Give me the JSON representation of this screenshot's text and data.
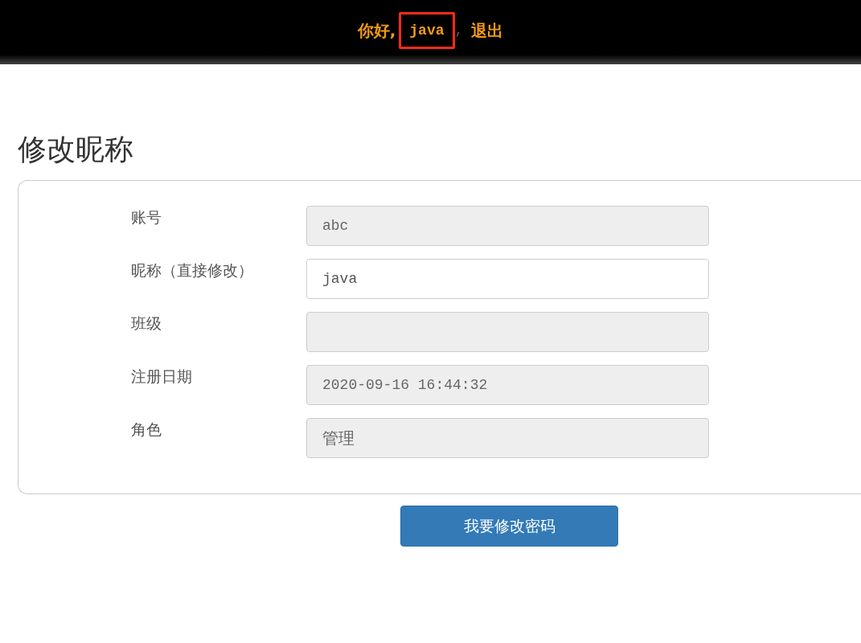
{
  "header": {
    "greeting": "你好,",
    "username": {
      "text": "java",
      "highlighted": true
    },
    "separator": ",",
    "logout": "退出"
  },
  "title": "修改昵称",
  "fields": [
    {
      "label": "账号",
      "value": "abc",
      "disabled": true,
      "kind": "mono"
    },
    {
      "label": "昵称（直接修改）",
      "value": "java",
      "disabled": false,
      "kind": "mono"
    },
    {
      "label": "班级",
      "disabled": true,
      "kind": "mono"
    },
    {
      "label": "注册日期",
      "value": "2020-09-16 16:44:32",
      "disabled": true,
      "kind": "mono"
    },
    {
      "label": "角色",
      "value": "管理",
      "disabled": true,
      "kind": "sans"
    }
  ],
  "button": "我要修改密码"
}
